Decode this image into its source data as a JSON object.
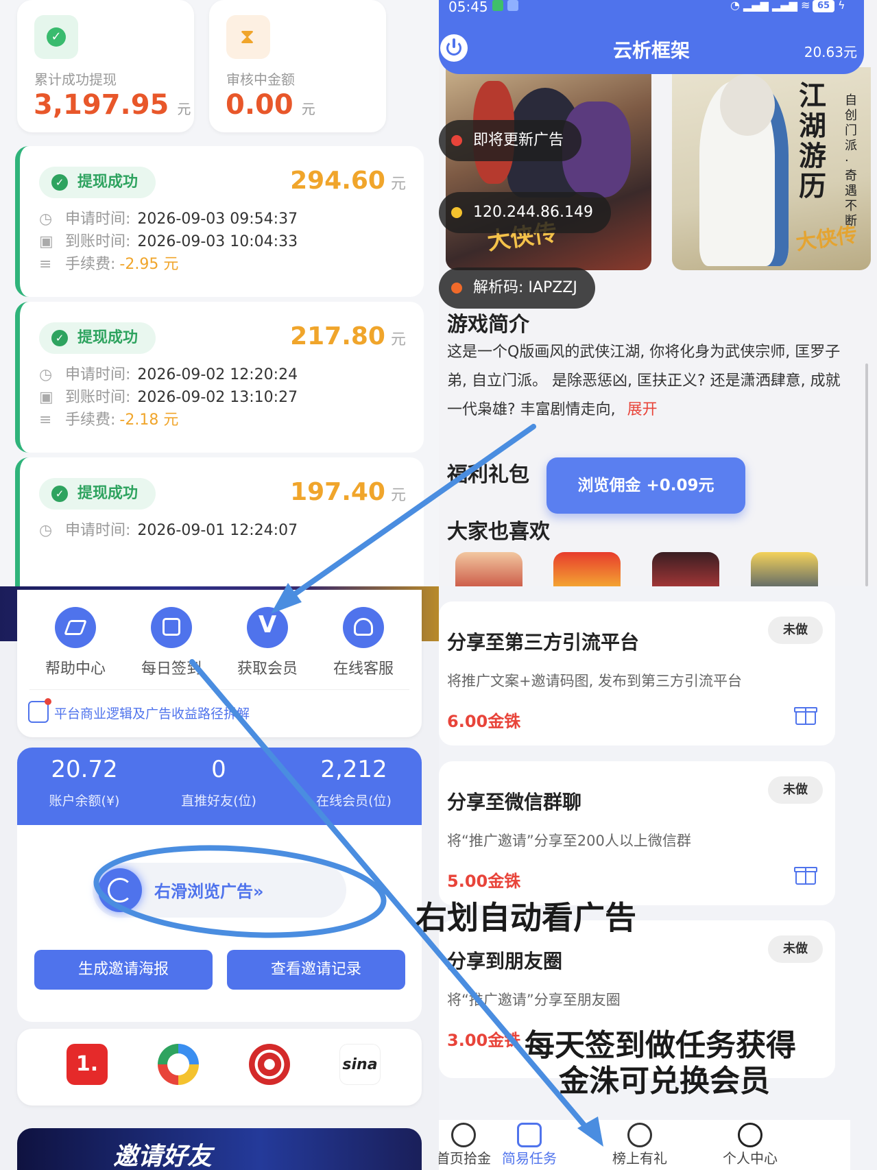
{
  "q1": {
    "stats": [
      {
        "label": "累计成功提现",
        "value": "3,197.95",
        "unit": "元",
        "icon": "check-circle-icon"
      },
      {
        "label": "审核中金额",
        "value": "0.00",
        "unit": "元",
        "icon": "hourglass-icon"
      }
    ],
    "records": [
      {
        "status": "提现成功",
        "amount": "294.60",
        "unit": "元",
        "apply_label": "申请时间:",
        "apply_time": "2026-09-03 09:54:37",
        "arrive_label": "到账时间:",
        "arrive_time": "2026-09-03 10:04:33",
        "fee_label": "手续费:",
        "fee": "-2.95 元"
      },
      {
        "status": "提现成功",
        "amount": "217.80",
        "unit": "元",
        "apply_label": "申请时间:",
        "apply_time": "2026-09-02 12:20:24",
        "arrive_label": "到账时间:",
        "arrive_time": "2026-09-02 13:10:27",
        "fee_label": "手续费:",
        "fee": "-2.18 元"
      },
      {
        "status": "提现成功",
        "amount": "197.40",
        "unit": "元",
        "apply_label": "申请时间:",
        "apply_time": "2026-09-01 12:24:07"
      }
    ]
  },
  "q2": {
    "status_time": "05:45",
    "battery": "65",
    "title": "云析框架",
    "balance": "20.63元",
    "sticker_update": "即将更新广告",
    "sticker_ip": "120.244.86.149",
    "sticker_code": "解析码: IAPZZJ",
    "poster_right_title": "江湖游历",
    "poster_right_side": "自创门派·奇遇不断",
    "poster_brand": "大侠传",
    "intro_title": "游戏简介",
    "intro_text": "这是一个Q版画风的武侠江湖, 你将化身为武侠宗师, 匡罗子弟, 自立门派。 是除恶惩凶, 匡扶正义? 还是潇洒肆意, 成就一代枭雄? 丰富剧情走向,",
    "expand": "展开",
    "gift_title": "福利礼包",
    "browse_bonus": "浏览佣金 +0.09元",
    "like_title": "大家也喜欢"
  },
  "q3": {
    "menu": [
      {
        "label": "帮助中心",
        "icon": "compass-icon"
      },
      {
        "label": "每日签到",
        "icon": "calendar-icon"
      },
      {
        "label": "获取会员",
        "icon": "vip-icon"
      },
      {
        "label": "在线客服",
        "icon": "headset-icon"
      }
    ],
    "notice": "平台商业逻辑及广告收益路径拆解",
    "stats": [
      {
        "value": "20.72",
        "label": "账户余额(¥)"
      },
      {
        "value": "0",
        "label": "直推好友(位)"
      },
      {
        "value": "2,212",
        "label": "在线会员(位)"
      }
    ],
    "slider": "右滑浏览广告»",
    "btn_poster": "生成邀请海报",
    "btn_records": "查看邀请记录",
    "apps": [
      "1.",
      "",
      "",
      "sina"
    ],
    "banner": "邀请好友"
  },
  "q4": {
    "tasks": [
      {
        "title": "分享至第三方引流平台",
        "desc": "将推广文案+邀请码图, 发布到第三方引流平台",
        "reward": "6.00金铢",
        "status": "未做"
      },
      {
        "title": "分享至微信群聊",
        "desc": "将“推广邀请”分享至200人以上微信群",
        "reward": "5.00金铢",
        "status": "未做"
      },
      {
        "title": "分享到朋友圈",
        "desc": "将“推广邀请”分享至朋友圈",
        "reward": "3.00金铢",
        "status": "未做"
      }
    ],
    "nav": [
      {
        "label": "首页拾金",
        "icon": "home-icon"
      },
      {
        "label": "简易任务",
        "icon": "task-icon"
      },
      {
        "label": "榜上有礼",
        "icon": "chart-icon"
      },
      {
        "label": "个人中心",
        "icon": "user-icon"
      }
    ]
  },
  "annotations": {
    "swipe": "右划自动看广告",
    "tasks_line1": "每天签到做任务获得",
    "tasks_line2": "金洙可兑换会员"
  },
  "colors": {
    "primary": "#4f73ec",
    "success": "#2ea35f",
    "orange": "#f0a52b",
    "red": "#e8443a",
    "arrow": "#4a8de0"
  }
}
